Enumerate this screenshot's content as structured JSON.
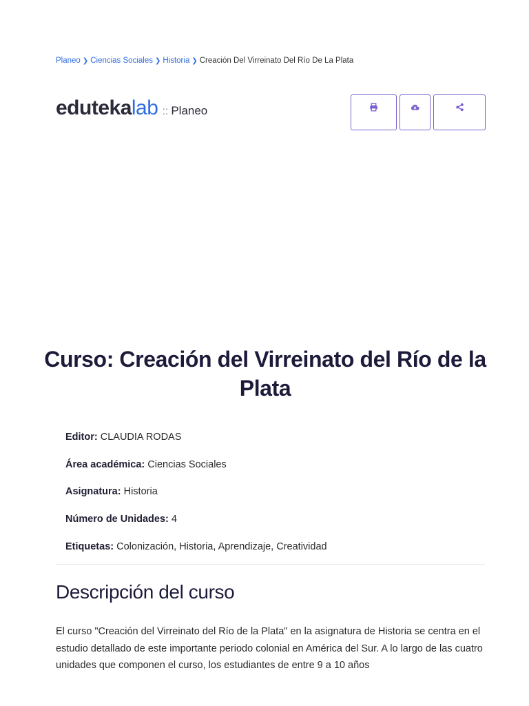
{
  "breadcrumb": {
    "items": [
      "Planeo",
      "Ciencias Sociales",
      "Historia"
    ],
    "current": "Creación Del Virreinato Del Río De La Plata"
  },
  "logo": {
    "brand_part1": "edutekа",
    "brand_part2": "lab",
    "separator": "::",
    "product": "Planeo"
  },
  "actions": {
    "print_icon": "print-icon",
    "download_icon": "cloud-download-icon",
    "share_icon": "share-icon",
    "accent_color": "#7a5fd0"
  },
  "course": {
    "title": "Curso: Creación del Virreinato del Río de la Plata",
    "meta": [
      {
        "label": "Editor:",
        "value": " CLAUDIA RODAS"
      },
      {
        "label": "Área académica:",
        "value": " Ciencias Sociales"
      },
      {
        "label": "Asignatura:",
        "value": " Historia"
      },
      {
        "label": "Número de Unidades:",
        "value": " 4"
      },
      {
        "label": "Etiquetas:",
        "value": " Colonización, Historia, Aprendizaje, Creatividad"
      }
    ]
  },
  "description": {
    "heading": "Descripción del curso",
    "text": "El curso \"Creación del Virreinato del Río de la Plata\" en la asignatura de Historia se centra en el estudio detallado de este importante periodo colonial en América del Sur. A lo largo de las cuatro unidades que componen el curso, los estudiantes de entre 9 a 10 años"
  },
  "colors": {
    "link": "#2f6de1",
    "title": "#1d1b3a"
  }
}
